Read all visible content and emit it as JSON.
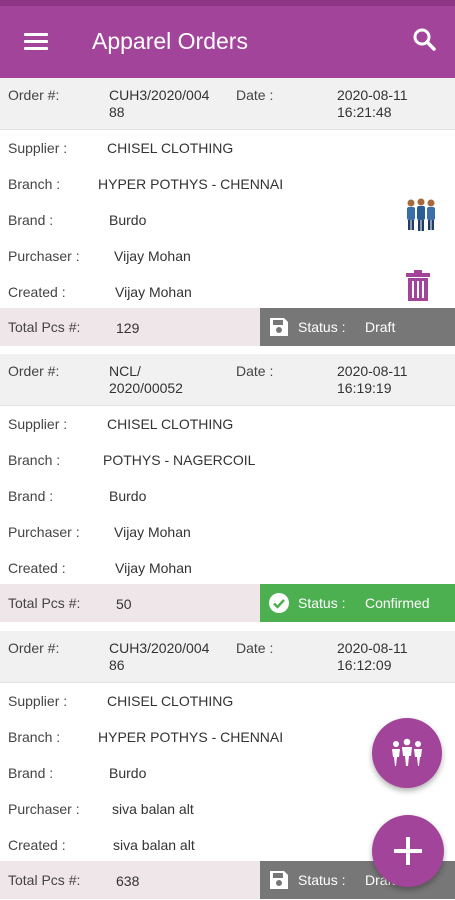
{
  "app": {
    "title": "Apparel Orders"
  },
  "icons": {
    "menu": "menu-icon",
    "search": "search-icon",
    "team": "team-icon",
    "delete": "trash-icon",
    "save": "save-icon",
    "check": "check-circle-icon",
    "group": "group-icon",
    "add": "plus-icon"
  },
  "colors": {
    "primary": "#a3449b",
    "draft": "#777777",
    "confirmed": "#4caf50"
  },
  "labels": {
    "order": "Order #:",
    "date": "Date :",
    "supplier": "Supplier :",
    "branch": "Branch :",
    "brand": "Brand :",
    "purchaser": "Purchaser :",
    "created": "Created :",
    "total": "Total Pcs #:",
    "status": "Status :"
  },
  "orders": [
    {
      "order_no_1": "CUH3/2020/004",
      "order_no_2": "88",
      "date": "2020-08-11",
      "time": "16:21:48",
      "supplier": "CHISEL CLOTHING",
      "branch": "HYPER POTHYS - CHENNAI",
      "brand": "Burdo",
      "purchaser": "Vijay Mohan",
      "created": "Vijay Mohan",
      "total": "129",
      "status": "Draft"
    },
    {
      "order_no_1": "NCL/",
      "order_no_2": "2020/00052",
      "date": "2020-08-11",
      "time": "16:19:19",
      "supplier": "CHISEL CLOTHING",
      "branch": "POTHYS - NAGERCOIL",
      "brand": "Burdo",
      "purchaser": "Vijay Mohan",
      "created": "Vijay Mohan",
      "total": "50",
      "status": "Confirmed"
    },
    {
      "order_no_1": "CUH3/2020/004",
      "order_no_2": "86",
      "date": "2020-08-11",
      "time": "16:12:09",
      "supplier": "CHISEL CLOTHING",
      "branch": "HYPER POTHYS - CHENNAI",
      "brand": "Burdo",
      "purchaser": "siva balan alt",
      "created": "siva balan alt",
      "total": "638",
      "status": "Draft"
    }
  ]
}
